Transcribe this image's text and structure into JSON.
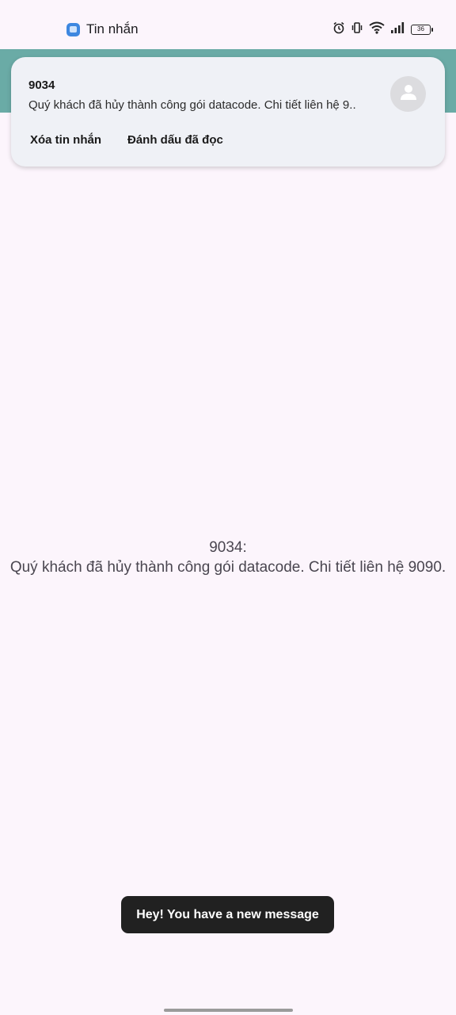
{
  "status_bar": {
    "app_name": "Tin nhắn",
    "battery_level": "36",
    "icons": [
      "alarm-icon",
      "vibrate-icon",
      "wifi-icon",
      "signal-icon",
      "battery-icon"
    ]
  },
  "notification": {
    "sender": "9034",
    "preview": "Quý khách đã hủy thành công gói datacode. Chi tiết liên hệ 9..",
    "avatar_icon": "person-icon",
    "actions": {
      "delete": "Xóa tin nhắn",
      "mark_read": "Đánh dấu đã đọc"
    }
  },
  "message": {
    "sender_line": "9034:",
    "body": "Quý khách đã hủy thành công gói datacode. Chi tiết liên hệ 9090."
  },
  "toast": {
    "text": "Hey! You have a new message"
  },
  "colors": {
    "background": "#fcf5fc",
    "app_bar": "#6aaba6",
    "notification_card": "#eff1f6",
    "toast": "#212121"
  }
}
